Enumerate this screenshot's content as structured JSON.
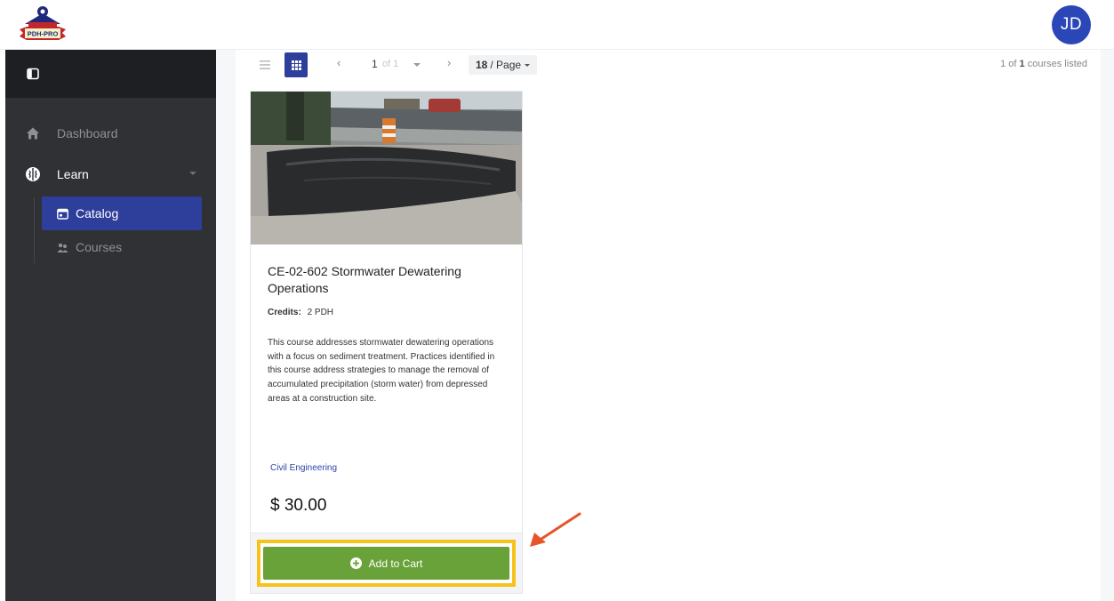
{
  "header": {
    "logo_text": "PDH-PRO",
    "avatar_initials": "JD"
  },
  "sidebar": {
    "items": [
      {
        "label": "Dashboard",
        "icon": "home-icon"
      },
      {
        "label": "Learn",
        "icon": "brain-icon"
      }
    ],
    "sub_items": [
      {
        "label": "Catalog",
        "icon": "calendar-icon",
        "active": true
      },
      {
        "label": "Courses",
        "icon": "users-icon",
        "active": false
      }
    ]
  },
  "toolbar": {
    "prev_symbol": "‹",
    "next_symbol": "›",
    "page_current": "1",
    "page_of": "of 1",
    "per_page_value": "18",
    "per_page_suffix": "/ Page",
    "listed_prefix": "1 of",
    "listed_count": "1",
    "listed_suffix": "courses listed"
  },
  "course": {
    "title": "CE-02-602 Stormwater Dewatering Operations",
    "credits_label": "Credits:",
    "credits_value": "2 PDH",
    "description": "This course addresses stormwater dewatering operations with a focus on sediment treatment. Practices identified in this course address strategies to manage the removal of accumulated precipitation (storm water) from depressed areas at a construction site.",
    "category": "Civil Engineering",
    "price": "$ 30.00",
    "add_to_cart_label": "Add to Cart"
  },
  "colors": {
    "sidebar_bg": "#2f3135",
    "active_nav": "#2d3e9b",
    "cart_button": "#6aa23a",
    "highlight_border": "#f6c21b",
    "annotation_arrow": "#e8542a",
    "avatar_bg": "#2b46b6"
  }
}
